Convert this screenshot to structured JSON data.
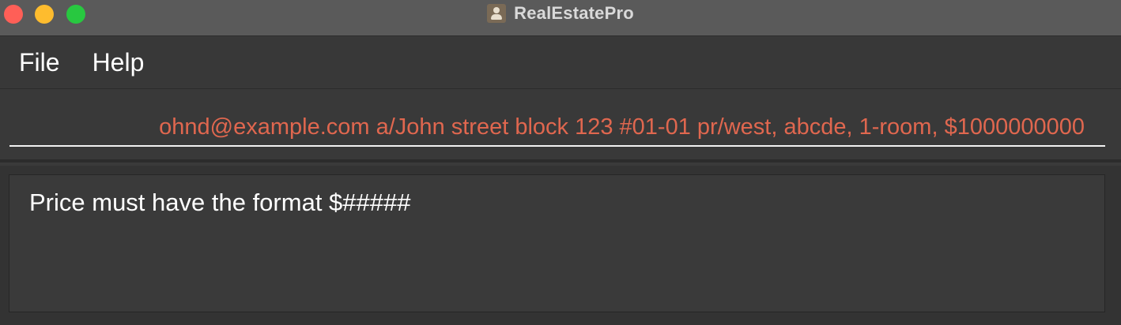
{
  "window": {
    "title": "RealEstatePro",
    "app_icon": "contacts-icon"
  },
  "menu": {
    "items": [
      {
        "label": "File"
      },
      {
        "label": "Help"
      }
    ]
  },
  "command_box": {
    "value": "ohnd@example.com a/John street block 123 #01-01 pr/west, abcde, 1-room, $1000000000",
    "text_color": "#e0674f"
  },
  "result_display": {
    "text": "Price must have the format $#####"
  }
}
